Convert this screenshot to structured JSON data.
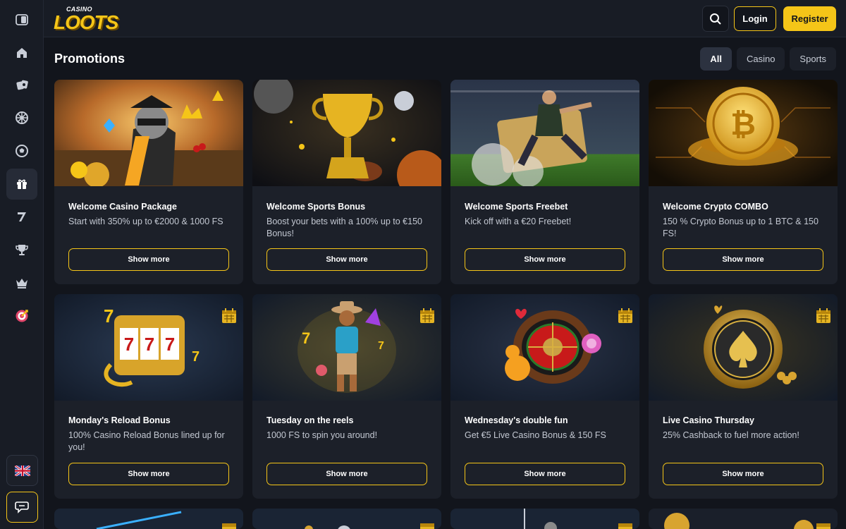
{
  "logo": {
    "top": "CASINO",
    "main": "LOOTS"
  },
  "header": {
    "login_label": "Login",
    "register_label": "Register"
  },
  "sidebar": {
    "items": [
      {
        "icon": "collapse-icon"
      },
      {
        "icon": "home-icon"
      },
      {
        "icon": "slots-icon"
      },
      {
        "icon": "roulette-icon"
      },
      {
        "icon": "sports-ball-icon"
      },
      {
        "icon": "gift-icon"
      },
      {
        "icon": "seven-icon"
      },
      {
        "icon": "trophy-icon"
      },
      {
        "icon": "crown-icon"
      },
      {
        "icon": "target-icon"
      }
    ],
    "language_icon": "uk-flag-icon",
    "chat_icon": "chat-icon"
  },
  "page": {
    "title": "Promotions"
  },
  "filters": [
    {
      "label": "All",
      "active": true
    },
    {
      "label": "Casino",
      "active": false
    },
    {
      "label": "Sports",
      "active": false
    }
  ],
  "promotions": [
    {
      "title": "Welcome Casino Package",
      "description": "Start with 350% up to €2000 & 1000 FS",
      "button": "Show more"
    },
    {
      "title": "Welcome Sports Bonus",
      "description": "Boost your bets with a 100% up to €150 Bonus!",
      "button": "Show more"
    },
    {
      "title": "Welcome Sports Freebet",
      "description": "Kick off with a €20 Freebet!",
      "button": "Show more"
    },
    {
      "title": "Welcome Crypto COMBO",
      "description": "150 % Crypto Bonus up to 1 BTC & 150 FS!",
      "button": "Show more"
    },
    {
      "title": "Monday's Reload Bonus",
      "description": "100% Casino Reload Bonus lined up for you!",
      "button": "Show more"
    },
    {
      "title": "Tuesday on the reels",
      "description": "1000 FS to spin you around!",
      "button": "Show more"
    },
    {
      "title": "Wednesday's double fun",
      "description": "Get €5 Live Casino Bonus & 150 FS",
      "button": "Show more"
    },
    {
      "title": "Live Casino Thursday",
      "description": "25% Cashback to fuel more action!",
      "button": "Show more"
    }
  ],
  "colors": {
    "accent": "#f5c518",
    "background": "#12151c",
    "card": "#1c2029"
  }
}
